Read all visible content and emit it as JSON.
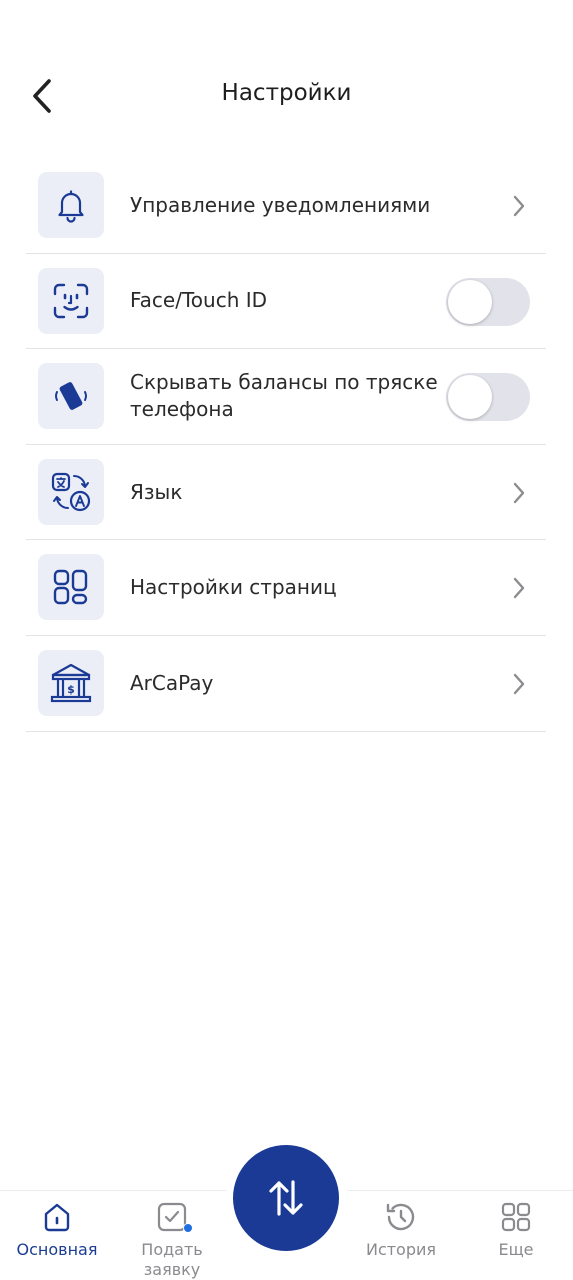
{
  "header": {
    "title": "Настройки"
  },
  "settings": {
    "items": [
      {
        "label": "Управление уведомлениями",
        "icon": "bell-icon",
        "control": "chevron"
      },
      {
        "label": "Face/Touch ID",
        "icon": "face-id-icon",
        "control": "toggle",
        "enabled": false
      },
      {
        "label": "Скрывать балансы по тряске телефона",
        "icon": "shake-phone-icon",
        "control": "toggle",
        "enabled": false
      },
      {
        "label": "Язык",
        "icon": "translate-icon",
        "control": "chevron"
      },
      {
        "label": "Настройки страниц",
        "icon": "widgets-icon",
        "control": "chevron"
      },
      {
        "label": "ArCaPay",
        "icon": "bank-icon",
        "control": "chevron"
      }
    ]
  },
  "nav": {
    "items": [
      {
        "label": "Основная",
        "icon": "home-icon",
        "active": true
      },
      {
        "label": "Подать заявку",
        "icon": "application-icon",
        "active": false
      },
      {
        "label": "История",
        "icon": "history-icon",
        "active": false
      },
      {
        "label": "Еще",
        "icon": "grid-icon",
        "active": false
      }
    ],
    "center_action_icon": "transfer-arrows-icon"
  },
  "colors": {
    "accent": "#1a3a95",
    "icon_bg": "#eceef7",
    "toggle_off": "#e2e3ea",
    "notification_dot": "#1f6fe0"
  }
}
